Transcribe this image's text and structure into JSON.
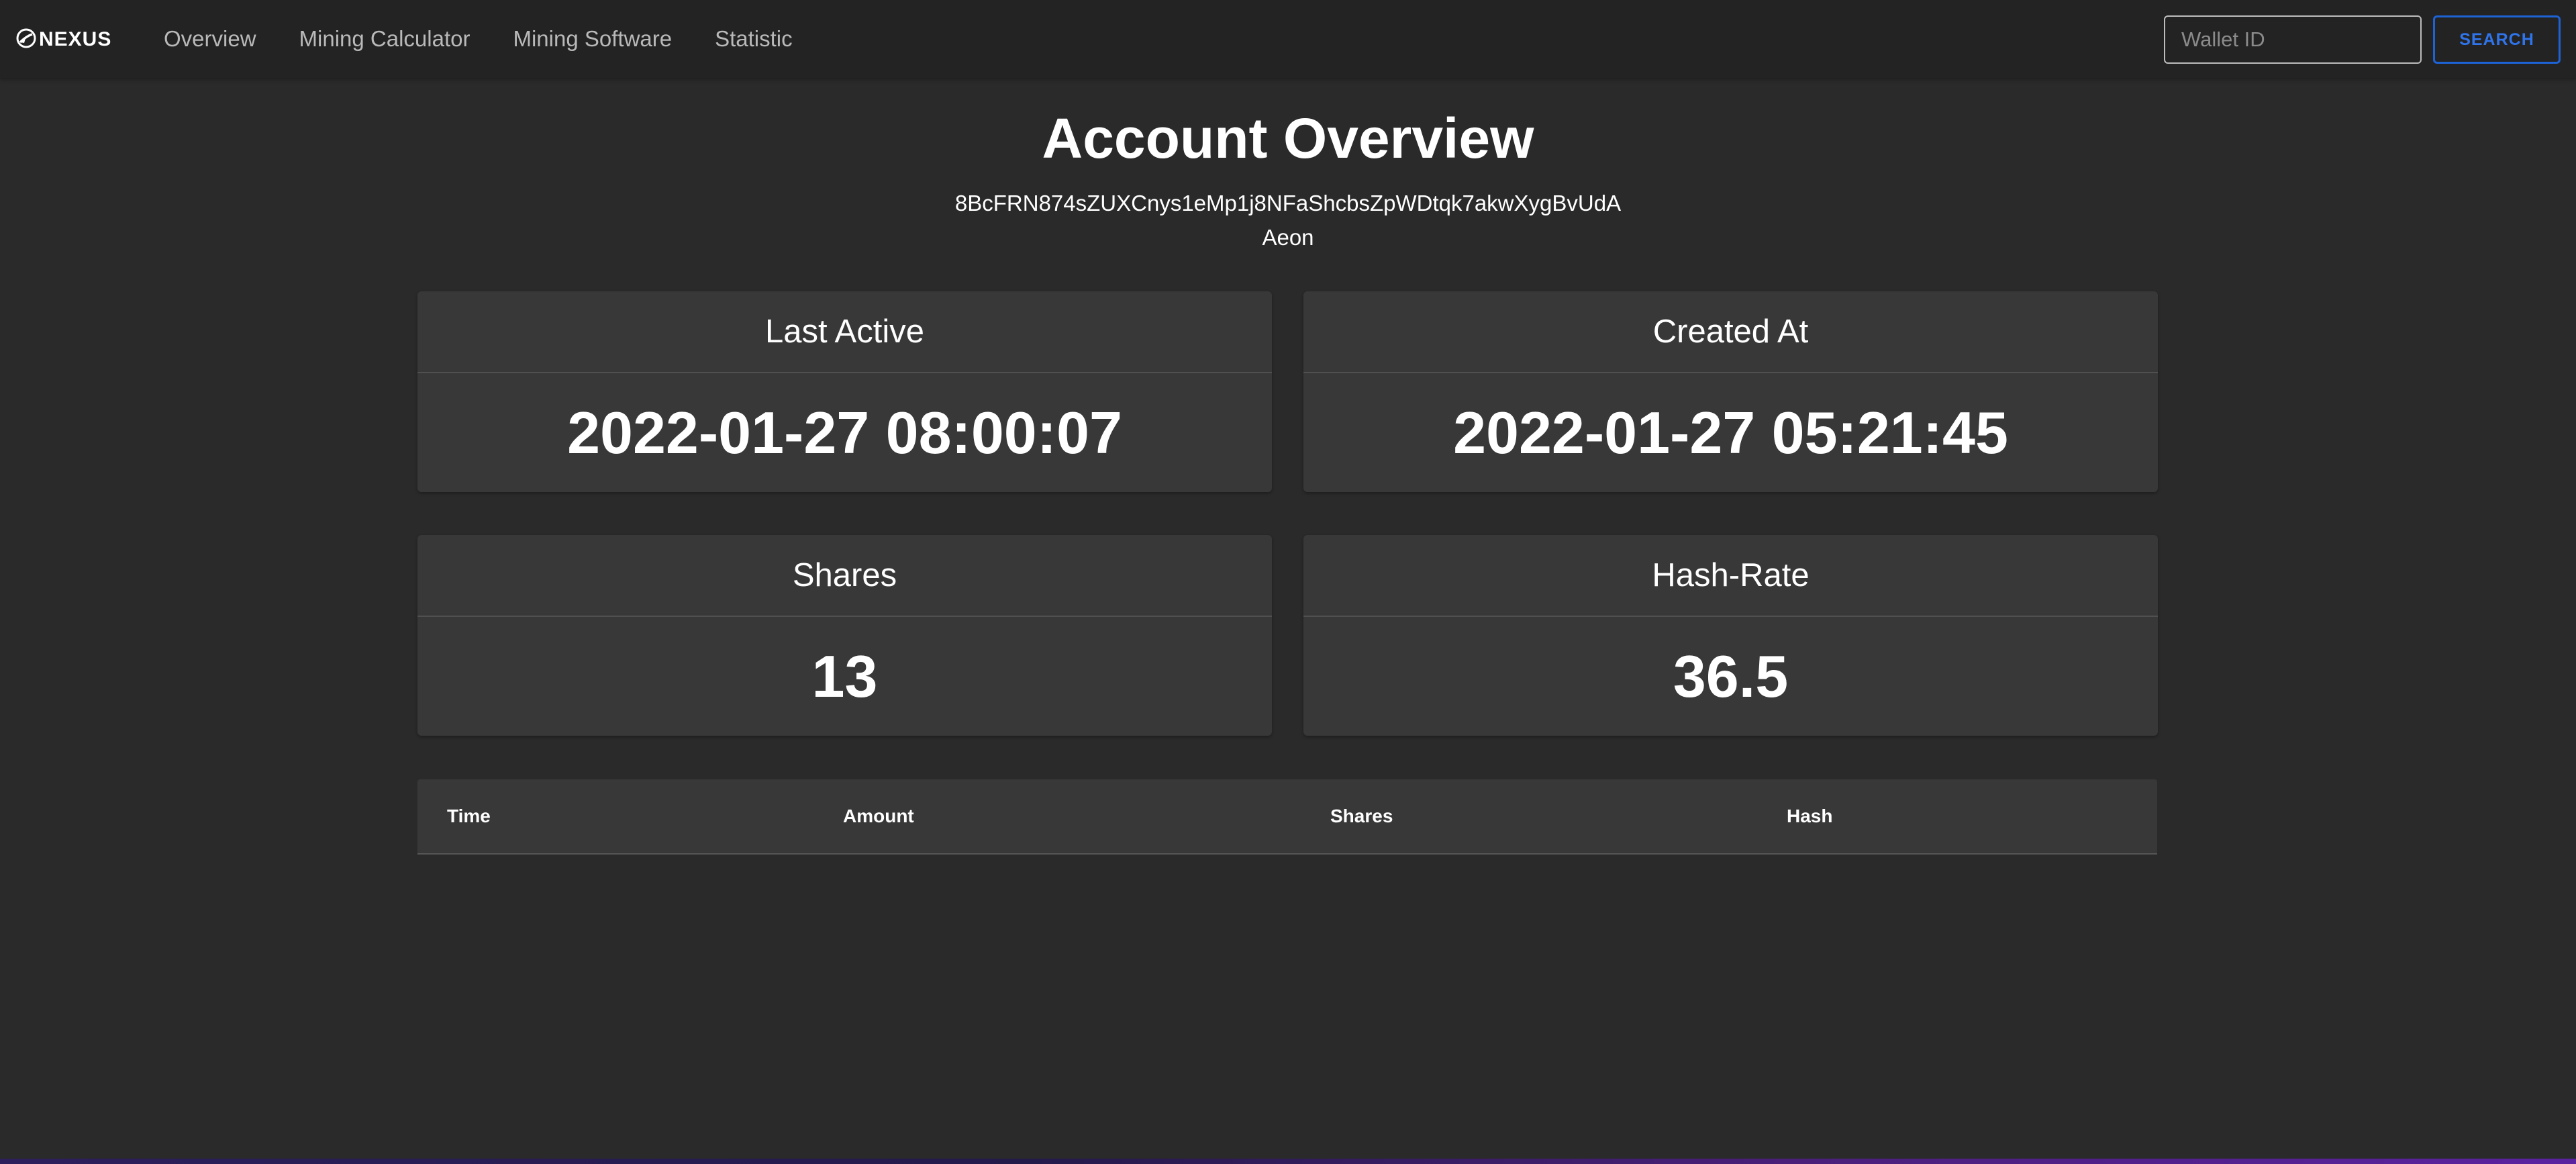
{
  "navbar": {
    "brand": "NEXUS",
    "links": [
      "Overview",
      "Mining Calculator",
      "Mining Software",
      "Statistic"
    ],
    "search_placeholder": "Wallet ID",
    "search_value": "",
    "search_button": "SEARCH"
  },
  "page": {
    "title": "Account Overview",
    "wallet_id": "8BcFRN874sZUXCnys1eMp1j8NFaShcbsZpWDtqk7akwXygBvUdA",
    "coin": "Aeon"
  },
  "cards": {
    "last_active": {
      "label": "Last Active",
      "value": "2022-01-27 08:00:07"
    },
    "created_at": {
      "label": "Created At",
      "value": "2022-01-27 05:21:45"
    },
    "shares": {
      "label": "Shares",
      "value": "13"
    },
    "hash_rate": {
      "label": "Hash-Rate",
      "value": "36.5"
    }
  },
  "table": {
    "headers": [
      "Time",
      "Amount",
      "Shares",
      "Hash"
    ],
    "rows": []
  },
  "colors": {
    "background": "#2a2a2a",
    "navbar": "#232323",
    "card": "#383838",
    "accent": "#1e63d6"
  }
}
